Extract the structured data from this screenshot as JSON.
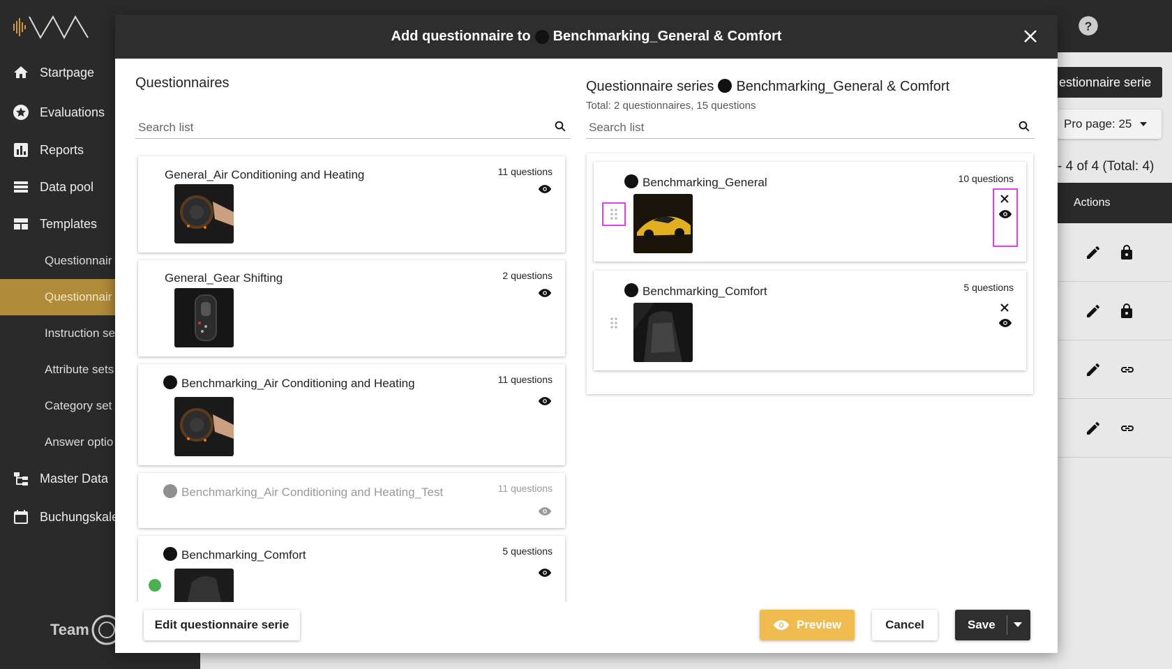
{
  "sidebar": {
    "items": [
      {
        "label": "Startpage",
        "icon": "home-icon"
      },
      {
        "label": "Evaluations",
        "icon": "star-icon"
      },
      {
        "label": "Reports",
        "icon": "bar-chart-icon"
      },
      {
        "label": "Data pool",
        "icon": "list-icon"
      },
      {
        "label": "Templates",
        "icon": "table-icon"
      }
    ],
    "subitems": [
      {
        "label": "Questionnair"
      },
      {
        "label": "Questionnair"
      },
      {
        "label": "Instruction se"
      },
      {
        "label": "Attribute sets"
      },
      {
        "label": "Category set"
      },
      {
        "label": "Answer optio"
      }
    ],
    "bottom_items": [
      {
        "label": "Master Data",
        "icon": "hierarchy-icon"
      },
      {
        "label": "Buchungskale",
        "icon": "calendar-icon"
      }
    ],
    "footer_logo": "Team"
  },
  "background": {
    "serie_button": "estionnaire serie",
    "per_page": "Pro page: 25",
    "count": "- 4 of 4 (Total: 4)",
    "actions_header": "Actions"
  },
  "modal": {
    "title_prefix": "Add questionnaire to",
    "title_name": "Benchmarking_General & Comfort",
    "left": {
      "title": "Questionnaires",
      "search_placeholder": "Search list",
      "items": [
        {
          "name": "General_Air Conditioning and Heating",
          "count": "11 questions"
        },
        {
          "name": "General_Gear Shifting",
          "count": "2 questions"
        },
        {
          "name": "Benchmarking_Air Conditioning and Heating",
          "count": "11 questions"
        },
        {
          "name": "Benchmarking_Air Conditioning and Heating_Test",
          "count": "11 questions"
        },
        {
          "name": "Benchmarking_Comfort",
          "count": "5 questions"
        }
      ]
    },
    "right": {
      "title_prefix": "Questionnaire series",
      "title_name": "Benchmarking_General & Comfort",
      "subtitle": "Total: 2 questionnaires, 15 questions",
      "search_placeholder": "Search list",
      "items": [
        {
          "name": "Benchmarking_General",
          "count": "10 questions"
        },
        {
          "name": "Benchmarking_Comfort",
          "count": "5 questions"
        }
      ]
    },
    "footer": {
      "edit_label": "Edit questionnaire serie",
      "preview_label": "Preview",
      "cancel_label": "Cancel",
      "save_label": "Save"
    }
  },
  "colors": {
    "accent": "#f0bb4f",
    "sidebar_active": "#b08c3a",
    "dark": "#2e2e2e",
    "highlight": "#e040e0"
  }
}
